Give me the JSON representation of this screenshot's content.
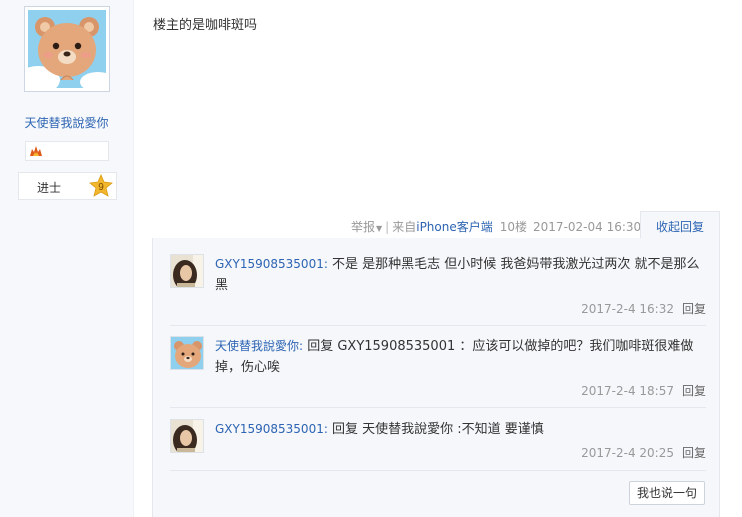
{
  "author": {
    "username": "天使替我說愛你",
    "level_title": "进士",
    "level_number": "9"
  },
  "post": {
    "content": "楼主的是咖啡斑吗",
    "report_label": "举报",
    "via_prefix": "来自",
    "via_client": "iPhone客户端",
    "floor": "10楼",
    "datetime": "2017-02-04 16:30",
    "collapse_label": "收起回复"
  },
  "replies": [
    {
      "user": "GXY15908535001",
      "text": "不是 是那种黑毛志 但小时候 我爸妈带我激光过两次 就不是那么黑",
      "time": "2017-2-4 16:32",
      "reply_label": "回复"
    },
    {
      "user": "天使替我說愛你",
      "text": "回复 GXY15908535001 ：应该可以做掉的吧？我们咖啡斑很难做掉，伤心唉",
      "time": "2017-2-4 18:57",
      "reply_label": "回复"
    },
    {
      "user": "GXY15908535001",
      "text": "回复 天使替我說愛你 :不知道 要谨慎",
      "time": "2017-2-4 20:25",
      "reply_label": "回复"
    }
  ],
  "say_button_label": "我也说一句",
  "colors": {
    "link": "#2d64b3",
    "meta": "#999999",
    "panel_bg": "#f5f7fa",
    "sidebar_bg": "#f6f8fb",
    "star_gold": "#f2b72c"
  },
  "icons": {
    "author_avatar": "bear-avatar",
    "badge": "fire-badge-icon",
    "level": "star-badge-icon"
  }
}
